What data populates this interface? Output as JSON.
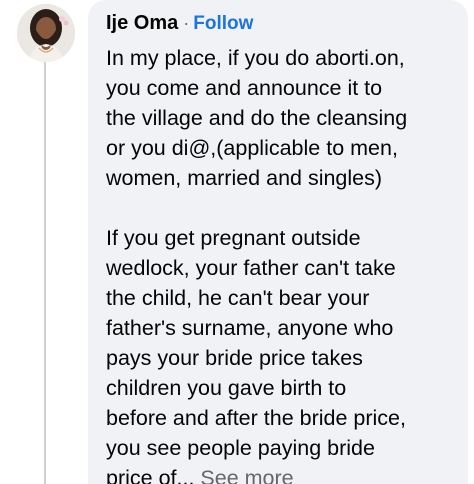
{
  "comment": {
    "author": "Ije Oma",
    "separator": "·",
    "follow_label": "Follow",
    "paragraph1": [
      "In my place, if you do aborti.on,",
      "you come and announce it to",
      "the village and do the cleansing",
      "or you di@,(applicable to men,",
      "women, married and singles)"
    ],
    "paragraph2": [
      "If you get pregnant outside",
      "wedlock, your father can't take",
      "the child, he can't bear your",
      "father's surname, anyone who",
      "pays your bride price takes",
      "children you gave birth to",
      "before and after the bride price,",
      "you see people paying bride"
    ],
    "last_line": "price of...",
    "see_more_label": "See more"
  },
  "colors": {
    "bubble": "#f0f2f5",
    "follow": "#1b74e4",
    "muted": "#65676b",
    "text": "#050505"
  }
}
